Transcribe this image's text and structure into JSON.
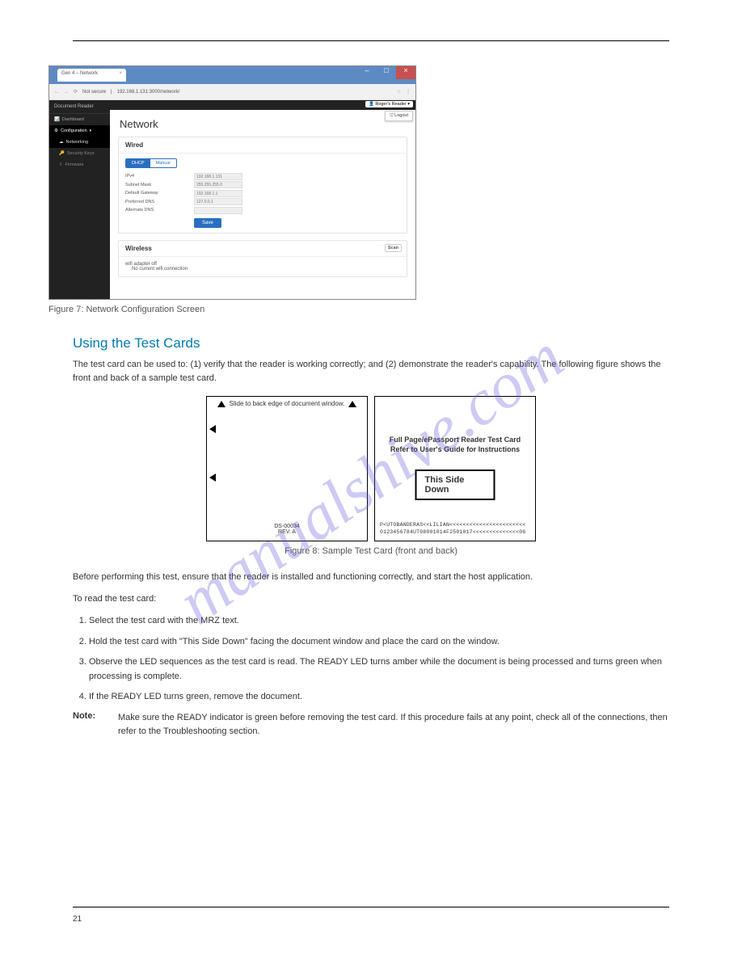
{
  "watermark": "manualshive.com",
  "page_number": "21",
  "hr": true,
  "screenshot": {
    "tab_title": "Gen 4 – Network",
    "url_security": "Not secure",
    "url": "192.168.1.131:3000/network/",
    "brand": "Document Reader",
    "user": "Roger's Reader",
    "logout": "Logout",
    "sidebar": {
      "dashboard": "Dashboard",
      "configuration": "Configuration",
      "networking": "Networking",
      "security_keys": "Security Keys",
      "firmware": "Firmware"
    },
    "page_title": "Network",
    "wired_title": "Wired",
    "dhcp_label": "DHCP",
    "manual_label": "Manual",
    "fields": {
      "ipv4": {
        "label": "IPv4",
        "value": "192.168.1.131"
      },
      "subnet": {
        "label": "Subnet Mask",
        "value": "255.255.255.0"
      },
      "gateway": {
        "label": "Default Gateway",
        "value": "192.168.1.1"
      },
      "pref_dns": {
        "label": "Preferred DNS",
        "value": "127.0.0.1"
      },
      "alt_dns": {
        "label": "Alternate DNS",
        "value": ""
      }
    },
    "save": "Save",
    "wireless_title": "Wireless",
    "wireless_status": "wifi adapter off",
    "wireless_note": "No current wifi connection",
    "scan": "Scan"
  },
  "caption1": "Figure 7: Network Configuration Screen",
  "section": {
    "heading": "Using the Test Cards",
    "intro": "The test card can be used to: (1) verify that the reader is working correctly; and (2) demonstrate the reader's capability. The following figure shows the front and back of a sample test card.",
    "front": {
      "top": "Slide to back edge of document window.",
      "ds": "DS-00034",
      "rev": "REV. A"
    },
    "back": {
      "line1": "Full Page/ePassport Reader Test Card",
      "line2": "Refer to User's Guide for Instructions",
      "boxed": "This Side Down",
      "mrz1": "P<UTOBANDERAS<<LILIAN<<<<<<<<<<<<<<<<<<<<<<<",
      "mrz2": "0123456784UT08001014F2501017<<<<<<<<<<<<<<06"
    },
    "figcap": "Figure 8: Sample Test Card (front and back)",
    "p1": "Before performing this test, ensure that the reader is installed and functioning correctly, and start the host application.",
    "p2": "To read the test card:",
    "steps": [
      "Select the test card with the MRZ text.",
      "Hold the test card with \"This Side Down\" facing the document window and place the card on the window.",
      "Observe the LED sequences as the test card is read. The READY LED turns amber while the document is being processed and turns green when processing is complete.",
      "If the READY LED turns green, remove the document."
    ],
    "note_label": "Note:",
    "note_body": "Make sure the READY indicator is green before removing the test card. If this procedure fails at any point, check all of the connections, then refer to the Troubleshooting section."
  }
}
